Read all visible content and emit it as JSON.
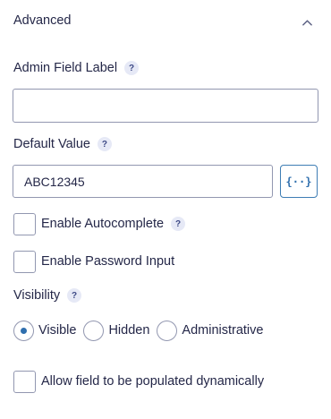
{
  "section": {
    "title": "Advanced",
    "collapse_icon": "chevron-up-icon"
  },
  "admin_label": {
    "label": "Admin Field Label",
    "help": "?",
    "value": ""
  },
  "default_value": {
    "label": "Default Value",
    "help": "?",
    "value": "ABC12345",
    "merge_tag_button": "{··}"
  },
  "autocomplete": {
    "label": "Enable Autocomplete",
    "help": "?",
    "checked": false
  },
  "password_input": {
    "label": "Enable Password Input",
    "checked": false
  },
  "visibility": {
    "label": "Visibility",
    "help": "?",
    "options": [
      {
        "label": "Visible",
        "selected": true
      },
      {
        "label": "Hidden",
        "selected": false
      },
      {
        "label": "Administrative",
        "selected": false
      }
    ]
  },
  "dynamic_population": {
    "label": "Allow field to be populated dynamically",
    "checked": false
  },
  "colors": {
    "text": "#242748",
    "accent": "#2f6fae",
    "border": "#9297b0",
    "help_bg": "#e6e9f6"
  }
}
